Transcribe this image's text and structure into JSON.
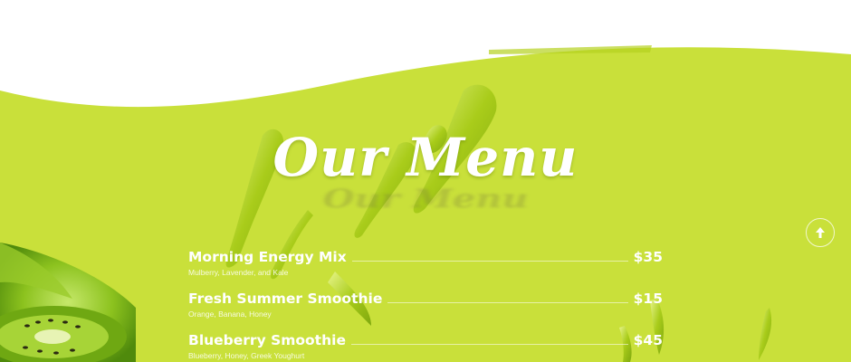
{
  "section": {
    "title": "Our Menu"
  },
  "menu": {
    "items": [
      {
        "name": "Morning Energy Mix",
        "price": "$35",
        "description": "Mulberry, Lavender, and Kale"
      },
      {
        "name": "Fresh Summer Smoothie",
        "price": "$15",
        "description": "Orange, Banana, Honey"
      },
      {
        "name": "Blueberry Smoothie",
        "price": "$45",
        "description": "Blueberry, Honey, Greek Youghurt"
      }
    ]
  },
  "scroll_top": {
    "icon": "arrow-up-icon"
  },
  "colors": {
    "background": "#c9e03a",
    "splash": "#b7d21e",
    "text": "#ffffff",
    "kiwi": "#86b81c"
  }
}
